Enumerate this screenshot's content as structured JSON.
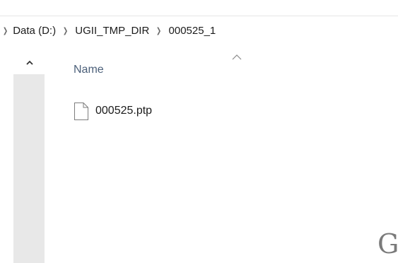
{
  "breadcrumb": {
    "items": [
      "Data (D:)",
      "UGII_TMP_DIR",
      "000525_1"
    ]
  },
  "file_list": {
    "column_header": "Name",
    "files": [
      {
        "name": "000525.ptp",
        "icon": "file-icon"
      }
    ]
  },
  "corner_glyph": "G",
  "colors": {
    "header_text": "#4c607a",
    "scroll_track": "#e8e8e8",
    "text": "#1b1b1b"
  }
}
